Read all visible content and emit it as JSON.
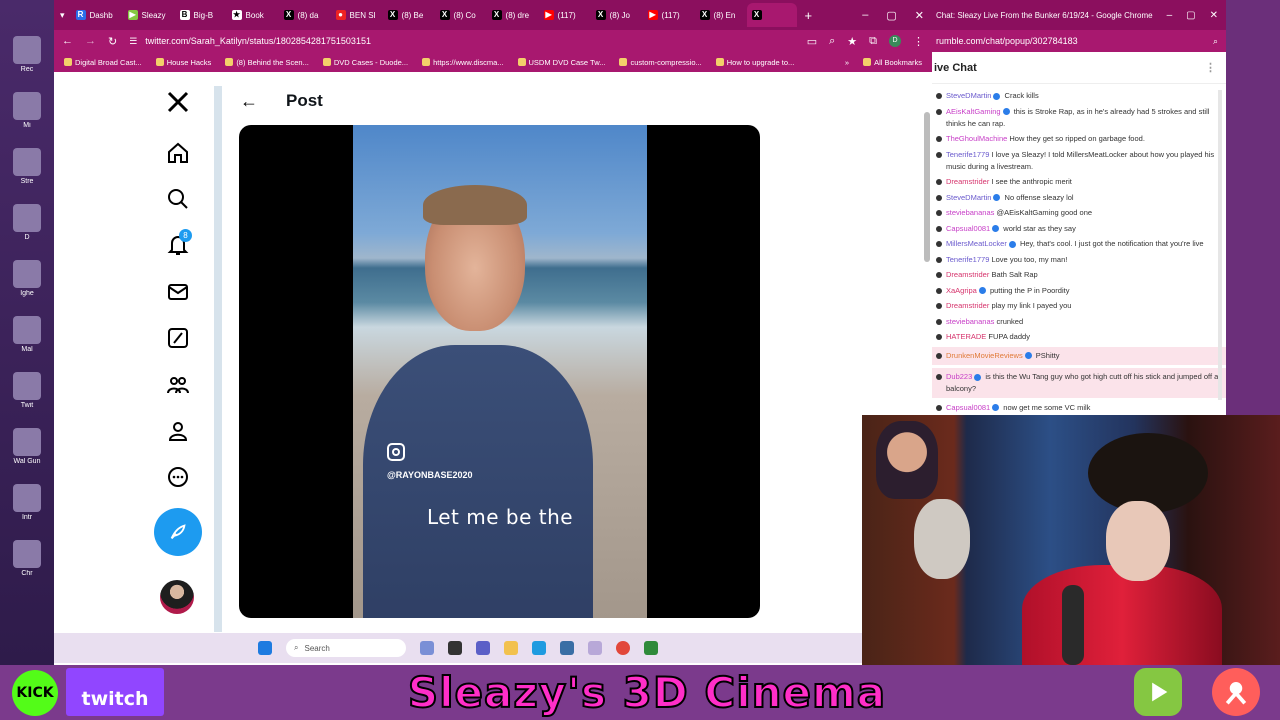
{
  "desktop": {
    "icons": [
      {
        "label": "Rec"
      },
      {
        "label": "Mi"
      },
      {
        "label": "Stre"
      },
      {
        "label": "D"
      },
      {
        "label": "Ighe"
      },
      {
        "label": "Mal"
      },
      {
        "label": "Twit"
      },
      {
        "label": "Wal Gun"
      },
      {
        "label": "Intr"
      },
      {
        "label": "Chr"
      }
    ]
  },
  "browser": {
    "tabs": [
      {
        "label": "Dashb",
        "icon_color": "#2b6de8",
        "icon_glyph": "R"
      },
      {
        "label": "Sleazy",
        "icon_color": "#85c742",
        "icon_glyph": "▶"
      },
      {
        "label": "Big-B",
        "icon_color": "#ffffff",
        "icon_glyph": "B"
      },
      {
        "label": "Book",
        "icon_color": "#ffffff",
        "icon_glyph": "★"
      },
      {
        "label": "(8) da",
        "icon_color": "#000000",
        "icon_glyph": "X"
      },
      {
        "label": "BEN SI",
        "icon_color": "#e22",
        "icon_glyph": "●"
      },
      {
        "label": "(8) Be",
        "icon_color": "#000000",
        "icon_glyph": "X"
      },
      {
        "label": "(8) Co",
        "icon_color": "#000000",
        "icon_glyph": "X"
      },
      {
        "label": "(8) dre",
        "icon_color": "#000000",
        "icon_glyph": "X"
      },
      {
        "label": "(117)",
        "icon_color": "#ff0000",
        "icon_glyph": "▶"
      },
      {
        "label": "(8) Jo",
        "icon_color": "#000000",
        "icon_glyph": "X"
      },
      {
        "label": "(117)",
        "icon_color": "#ff0000",
        "icon_glyph": "▶"
      },
      {
        "label": "(8) En",
        "icon_color": "#000000",
        "icon_glyph": "X"
      },
      {
        "label": "",
        "icon_color": "#000000",
        "icon_glyph": "X"
      }
    ],
    "new_tab": "+",
    "url": "twitter.com/Sarah_Katilyn/status/1802854281751503151",
    "bookmarks": [
      "Digital Broad Cast...",
      "House Hacks",
      "(8) Behind the Scen...",
      "DVD Cases - Duode...",
      "https://www.discma...",
      "USDM DVD Case Tw...",
      "custom-compressio...",
      "How to upgrade to..."
    ],
    "all_bookmarks": "All Bookmarks"
  },
  "x_page": {
    "notification_count": "8",
    "header_title": "Post",
    "video": {
      "handle": "@RAYONBASE2020",
      "caption": "Let me be the"
    }
  },
  "taskbar": {
    "search_placeholder": "Search"
  },
  "chat_window": {
    "title": "Chat: Sleazy Live From the Bunker 6/19/24 - Google Chrome",
    "url": "rumble.com/chat/popup/302784183",
    "header": "ive Chat",
    "messages": [
      {
        "user": "SteveDMartin",
        "color": "#6a5acd",
        "badge": true,
        "text": "Crack kills"
      },
      {
        "user": "AEisKaltGaming",
        "color": "#c73ec7",
        "badge": true,
        "text": "this is Stroke Rap, as in he's already had 5 strokes and still thinks he can rap."
      },
      {
        "user": "TheGhoulMachine",
        "color": "#c73ec7",
        "badge": false,
        "text": "How they get so ripped on garbage food."
      },
      {
        "user": "Tenerife1779",
        "color": "#6a5acd",
        "badge": false,
        "text": "I love ya Sleazy! I told MillersMeatLocker about how you played his music during a livestream."
      },
      {
        "user": "Dreamstrider",
        "color": "#d6336c",
        "badge": false,
        "text": "I see the anthropic merit"
      },
      {
        "user": "SteveDMartin",
        "color": "#6a5acd",
        "badge": true,
        "text": "No offense sleazy lol"
      },
      {
        "user": "steviebananas",
        "color": "#c73ec7",
        "badge": false,
        "text": "@AEisKaltGaming good one"
      },
      {
        "user": "Capsual0081",
        "color": "#c73ec7",
        "badge": true,
        "text": "world star as they say"
      },
      {
        "user": "MillersMeatLocker",
        "color": "#6a5acd",
        "badge": true,
        "text": "Hey, that's cool. I just got the notification that you're live"
      },
      {
        "user": "Tenerife1779",
        "color": "#6a5acd",
        "badge": false,
        "text": "Love you too, my man!"
      },
      {
        "user": "Dreamstrider",
        "color": "#d6336c",
        "badge": false,
        "text": "Bath Salt Rap"
      },
      {
        "user": "XaAgripa",
        "color": "#d6336c",
        "badge": true,
        "text": "putting the P in Poordity"
      },
      {
        "user": "Dreamstrider",
        "color": "#d6336c",
        "badge": false,
        "text": "play my link I payed you"
      },
      {
        "user": "steviebananas",
        "color": "#c73ec7",
        "badge": false,
        "text": "crunked"
      },
      {
        "user": "HATERADE",
        "color": "#d6336c",
        "badge": false,
        "text": "FUPA daddy"
      },
      {
        "user": "DrunkenMovieReviews",
        "color": "#e07b39",
        "badge": true,
        "text": "PShitty",
        "highlight": true
      },
      {
        "user": "Dub223",
        "color": "#c73ec7",
        "badge": true,
        "text": "is this the Wu Tang guy who got high cutt off his stick and jumped off a balcony?",
        "highlight": true
      },
      {
        "user": "Capsual0081",
        "color": "#c73ec7",
        "badge": true,
        "text": "now get me some VC milk"
      }
    ]
  },
  "banner": {
    "kick_label": "KICK",
    "twitch_label": "twitch",
    "title": "Sleazy's 3D Cinema"
  },
  "colors": {
    "browser_frame": "#8b0f5e",
    "x_blue": "#1d9bf0",
    "banner_title": "#ff2ec8",
    "kick_green": "#53fc18",
    "twitch_purple": "#9146ff",
    "rumble_green": "#85c742"
  }
}
